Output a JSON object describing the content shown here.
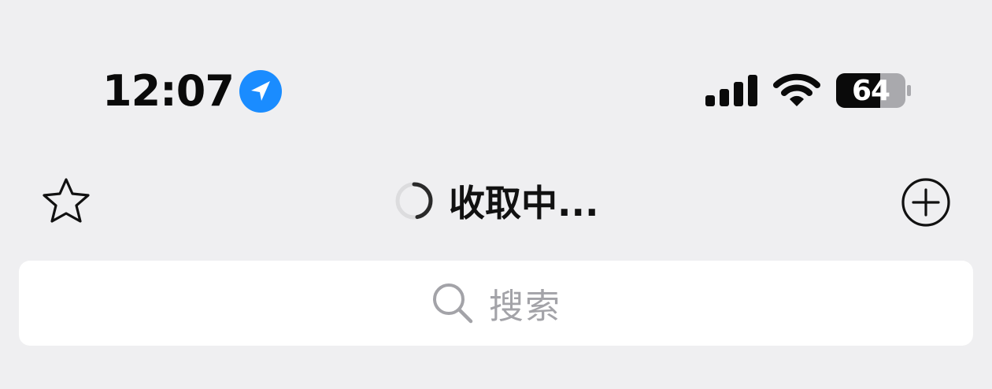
{
  "status_bar": {
    "time": "12:07",
    "location_icon": "location-arrow-icon",
    "signal_icon": "cellular-signal-icon",
    "wifi_icon": "wifi-icon",
    "battery_level": "64",
    "location_color": "#1a8cff"
  },
  "nav": {
    "star_icon": "star-icon",
    "title": "收取中...",
    "spinner_icon": "loading-spinner-icon",
    "add_icon": "plus-circle-icon"
  },
  "search": {
    "placeholder": "搜索",
    "icon": "search-icon"
  }
}
